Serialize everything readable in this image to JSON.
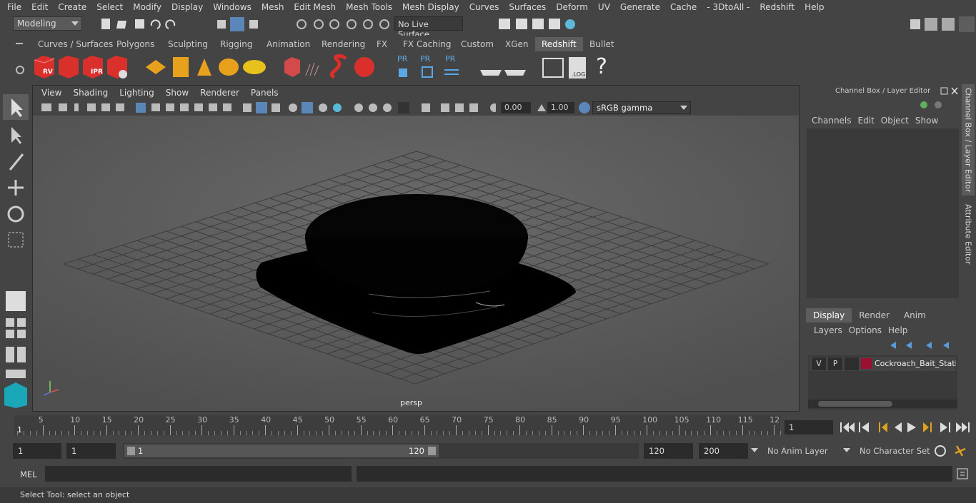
{
  "menu": [
    "File",
    "Edit",
    "Create",
    "Select",
    "Modify",
    "Display",
    "Windows",
    "Mesh",
    "Edit Mesh",
    "Mesh Tools",
    "Mesh Display",
    "Curves",
    "Surfaces",
    "Deform",
    "UV",
    "Generate",
    "Cache",
    "- 3DtoAll -",
    "Redshift",
    "Help"
  ],
  "status": {
    "mode": "Modeling",
    "live_surface": "No Live Surface"
  },
  "shelf_tabs": [
    "Curves / Surfaces",
    "Polygons",
    "Sculpting",
    "Rigging",
    "Animation",
    "Rendering",
    "FX",
    "FX Caching",
    "Custom",
    "XGen",
    "Redshift",
    "Bullet"
  ],
  "active_shelf": "Redshift",
  "shelf_icons": {
    "rv": "RV",
    "ipr": "IPR",
    "pr": "PR",
    "log": ".LOG",
    "help": "?"
  },
  "viewport": {
    "menu": [
      "View",
      "Shading",
      "Lighting",
      "Show",
      "Renderer",
      "Panels"
    ],
    "exposure": "0.00",
    "gamma": "1.00",
    "colorspace": "sRGB gamma",
    "camera": "persp"
  },
  "channel_box": {
    "title": "Channel Box / Layer Editor",
    "menu": [
      "Channels",
      "Edit",
      "Object",
      "Show"
    ]
  },
  "layer_editor": {
    "tabs": [
      "Display",
      "Render",
      "Anim"
    ],
    "active_tab": "Display",
    "menu": [
      "Layers",
      "Options",
      "Help"
    ],
    "layer": {
      "v": "V",
      "p": "P",
      "name": "Cockroach_Bait_Statio",
      "color": "#9b1030"
    }
  },
  "side_tabs": [
    "Channel Box / Layer Editor",
    "Attribute Editor"
  ],
  "timeline": {
    "ticks": [
      "5",
      "10",
      "15",
      "20",
      "25",
      "30",
      "35",
      "40",
      "45",
      "50",
      "55",
      "60",
      "65",
      "70",
      "75",
      "80",
      "85",
      "90",
      "95",
      "100",
      "105",
      "110",
      "115",
      "12"
    ],
    "start": "1",
    "current_frame": "1"
  },
  "range": {
    "start": "1",
    "start2": "1",
    "slider_start": "1",
    "slider_end": "120",
    "end": "120",
    "end2": "200",
    "anim_layer": "No Anim Layer",
    "char_set": "No Character Set"
  },
  "cmd": {
    "label": "MEL"
  },
  "help_line": "Select Tool: select an object"
}
